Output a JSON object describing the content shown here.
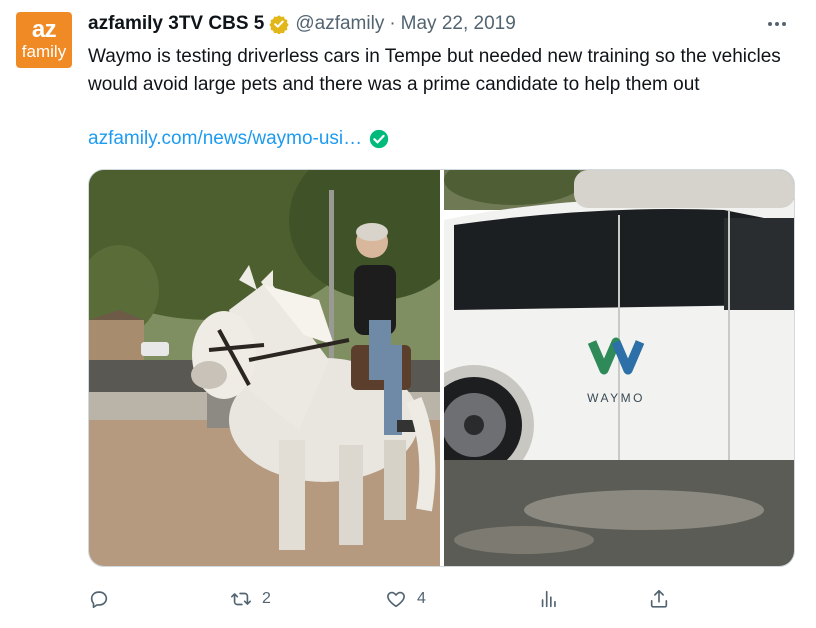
{
  "avatar": {
    "line1": "az",
    "line2": "family"
  },
  "author": {
    "name": "azfamily 3TV CBS 5",
    "handle": "@azfamily",
    "separator": "·",
    "date": "May 22, 2019"
  },
  "tweet": {
    "text": "Waymo is testing driverless cars in Tempe but needed new training so the vehicles would avoid large pets and there was a prime candidate to help them out",
    "link": "azfamily.com/news/waymo-usi…"
  },
  "media": {
    "car_logo_text": "WAYMO"
  },
  "actions": {
    "reply_count": "",
    "retweet_count": "2",
    "like_count": "4",
    "views_count": ""
  },
  "colors": {
    "accent": "#1d9bf0",
    "verified_gold": "#e2b719",
    "link_check": "#00ba7c",
    "muted": "#536471",
    "avatar_orange": "#f08a24"
  },
  "icons": [
    "gold-verified-icon",
    "more-icon",
    "verified-link-icon",
    "reply-icon",
    "retweet-icon",
    "like-icon",
    "views-icon",
    "share-icon"
  ]
}
